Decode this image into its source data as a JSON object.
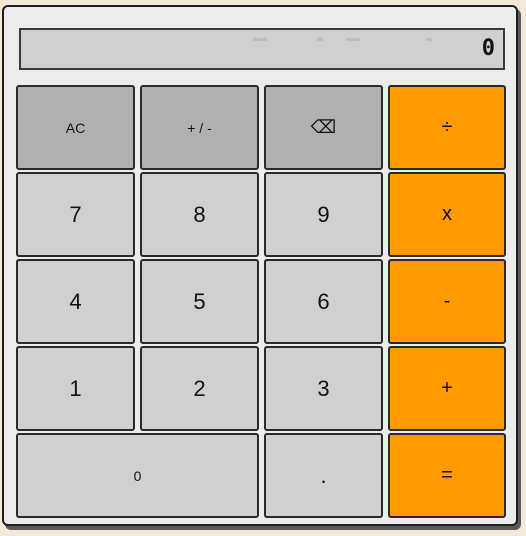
{
  "display": {
    "value": "0"
  },
  "buttons": {
    "ac": "AC",
    "plus_minus": "+ / -",
    "backspace": "⌫",
    "divide": "÷",
    "seven": "7",
    "eight": "8",
    "nine": "9",
    "multiply": "x",
    "four": "4",
    "five": "5",
    "six": "6",
    "subtract": "-",
    "one": "1",
    "two": "2",
    "three": "3",
    "add": "+",
    "zero": "0",
    "decimal": ".",
    "equals": "="
  },
  "colors": {
    "operator": "#ff9a00",
    "function": "#b0b0b0",
    "number": "#d0d0d0",
    "panel": "#ececec",
    "background": "#f3e9d8"
  }
}
